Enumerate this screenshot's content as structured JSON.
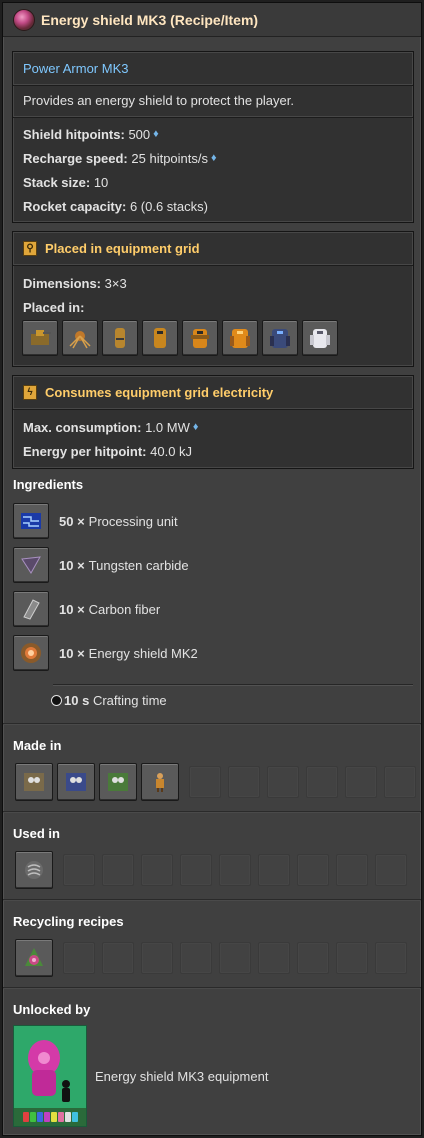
{
  "window": {
    "title": "Energy shield MK3 (Recipe/Item)",
    "icon": "energy-shield-mk3-icon"
  },
  "info": {
    "link": "Power Armor MK3",
    "description": "Provides an energy shield to protect the player.",
    "stats": [
      {
        "label": "Shield hitpoints:",
        "value": "500",
        "tooltip": true
      },
      {
        "label": "Recharge speed:",
        "value": "25 hitpoints/s",
        "tooltip": true
      },
      {
        "label": "Stack size:",
        "value": "10",
        "tooltip": false
      },
      {
        "label": "Rocket capacity:",
        "value": "6 (0.6 stacks)",
        "tooltip": false
      }
    ]
  },
  "placement": {
    "header": "Placed in equipment grid",
    "dimensions_label": "Dimensions:",
    "dimensions_value": "3×3",
    "placed_in_label": "Placed in:",
    "placed_in_icons": [
      "tank-icon",
      "spidertron-icon",
      "light-armor-icon",
      "heavy-armor-icon",
      "modular-armor-icon",
      "power-armor-icon",
      "power-armor-mk2-icon",
      "mech-armor-icon"
    ]
  },
  "electricity": {
    "header": "Consumes equipment grid electricity",
    "max_label": "Max. consumption:",
    "max_value": "1.0 MW",
    "energy_label": "Energy per hitpoint:",
    "energy_value": "40.0 kJ"
  },
  "ingredients": {
    "title": "Ingredients",
    "items": [
      {
        "qty": "50 ×",
        "name": "Processing unit",
        "icon": "processing-unit-icon"
      },
      {
        "qty": "10 ×",
        "name": "Tungsten carbide",
        "icon": "tungsten-carbide-icon"
      },
      {
        "qty": "10 ×",
        "name": "Carbon fiber",
        "icon": "carbon-fiber-icon"
      },
      {
        "qty": "10 ×",
        "name": "Energy shield MK2",
        "icon": "energy-shield-mk2-icon"
      }
    ],
    "crafting_time_value": "10 s",
    "crafting_time_label": "Crafting time"
  },
  "made_in": {
    "title": "Made in",
    "icons": [
      "assembling-machine-1-icon",
      "assembling-machine-2-icon",
      "assembling-machine-3-icon",
      "character-icon"
    ]
  },
  "used_in": {
    "title": "Used in",
    "icons": [
      "mech-armor-icon"
    ]
  },
  "recycling": {
    "title": "Recycling recipes",
    "icons": [
      "recycling-energy-shield-mk3-icon"
    ]
  },
  "unlocked_by": {
    "title": "Unlocked by",
    "tech_name": "Energy shield MK3 equipment",
    "icon": "technology-icon"
  },
  "colors": {
    "accent_header": "#ffcd6a",
    "link": "#7fc8ff",
    "tech_bg": "#2ea86a"
  }
}
